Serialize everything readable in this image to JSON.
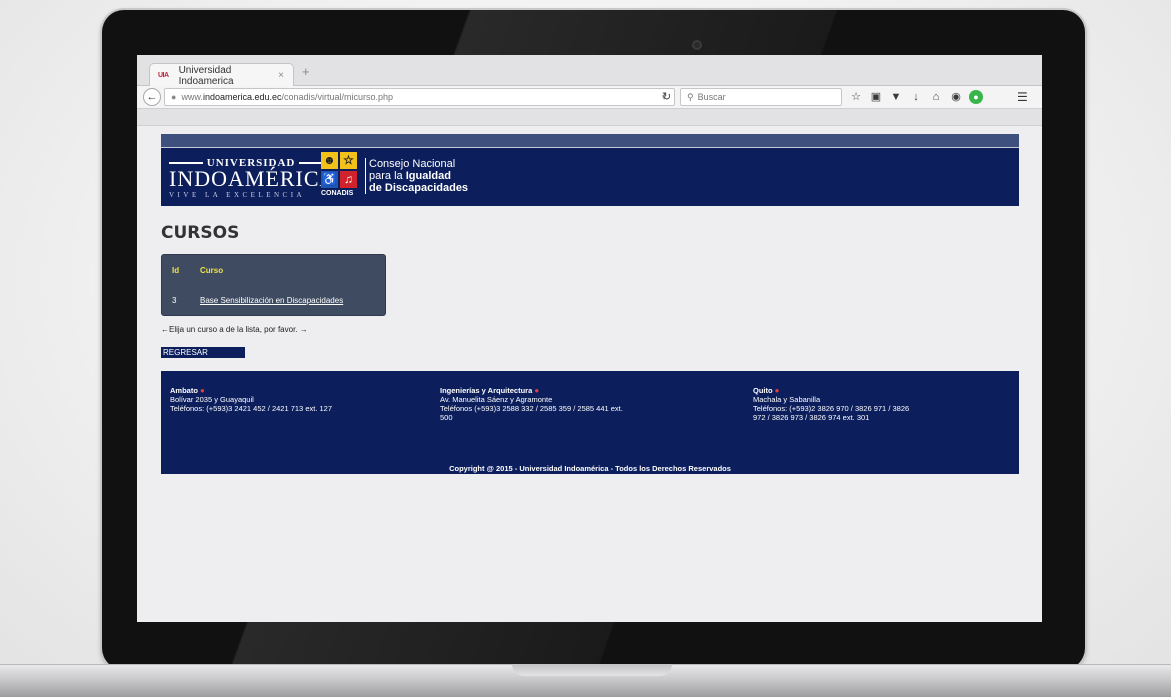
{
  "browser": {
    "tab_title": "Universidad Indoamerica",
    "tab_favicon": "UIA",
    "tab_close": "×",
    "new_tab": "+",
    "url_prefix": "www.",
    "url_domain": "indoamerica.edu.ec",
    "url_path": "/conadis/virtual/micurso.php",
    "search_placeholder": "Buscar",
    "icons": [
      "star-icon",
      "clipboard-icon",
      "pocket-icon",
      "download-icon",
      "home-icon",
      "chat-icon",
      "extension-icon",
      "menu-icon"
    ]
  },
  "header": {
    "uni_line1": "UNIVERSIDAD",
    "uni_line2": "INDOAMÉRICA",
    "uni_tagline": "VIVE LA EXCELENCIA",
    "conadis_label": "CONADIS",
    "conadis_line1": "Consejo Nacional",
    "conadis_line2a": "para la ",
    "conadis_line2b": "Igualdad",
    "conadis_line3": "de Discapacidades",
    "brand_color": "#0c1f5c"
  },
  "main": {
    "title": "CURSOS",
    "table": {
      "headers": [
        "Id",
        "Curso"
      ],
      "rows": [
        {
          "id": "3",
          "curso": "Base Sensibilización en Discapacidades"
        }
      ]
    },
    "hint": "←Elija un curso a de la lista, por favor. →",
    "back_button": "REGRESAR"
  },
  "footer": {
    "campuses": [
      {
        "name": "Ambato",
        "address": "Bolívar 2035 y Guayaquil",
        "phones": "Teléfonos: (+593)3 2421 452 / 2421 713 ext. 127"
      },
      {
        "name": "Ingenierías y Arquitectura",
        "address": "Av. Manuelita Sáenz y Agramonte",
        "phones": "Teléfonos (+593)3 2588 332 / 2585 359 / 2585 441 ext. 500"
      },
      {
        "name": "Quito",
        "address": "Machala y Sabanilla",
        "phones": "Teléfonos: (+593)2 3826 970 / 3826 971 / 3826 972 / 3826 973 / 3826 974 ext. 301"
      }
    ],
    "copyright": "Copyright @ 2015 - Universidad Indoamérica - Todos los Derechos Reservados"
  }
}
